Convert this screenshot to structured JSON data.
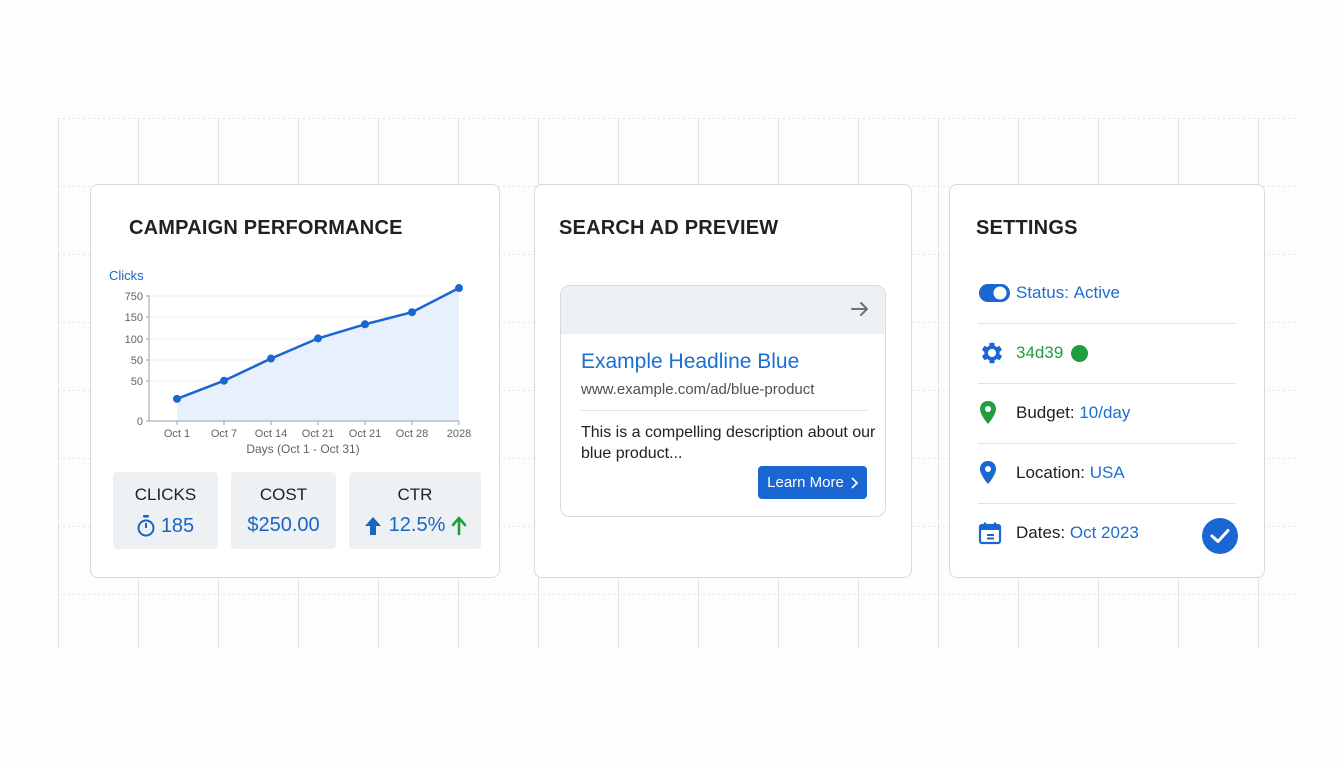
{
  "performance": {
    "title": "CAMPAIGN PERFORMANCE",
    "chart_data": {
      "type": "area",
      "ylabel": "Clicks",
      "xlabel": "Days (Oct 1 - Oct 31)",
      "y_tick_labels": [
        "0",
        "50",
        "50",
        "100",
        "150",
        "750"
      ],
      "x_tick_labels": [
        "Oct 1",
        "Oct 7",
        "Oct 14",
        "Oct 21",
        "Oct 21",
        "Oct 28",
        "2028"
      ],
      "values": [
        22,
        40,
        62,
        82,
        96,
        108,
        132
      ]
    },
    "stats": [
      {
        "label": "CLICKS",
        "value": "185",
        "icon": "timer-icon"
      },
      {
        "label": "COST",
        "value": "$250.00"
      },
      {
        "label": "CTR",
        "value": "12.5%",
        "icon": "arrow-up-icon"
      }
    ]
  },
  "ad_preview": {
    "title": "SEARCH AD PREVIEW",
    "headline": "Example Headline Blue",
    "url": "www.example.com/ad/blue-product",
    "description": "This is a compelling description about our blue product...",
    "button_label": "Learn More"
  },
  "settings": {
    "title": "SETTINGS",
    "status": {
      "label": "Status:",
      "value": "Active"
    },
    "id_value": "34d39",
    "budget": {
      "label": "Budget:",
      "value": "10/day"
    },
    "location": {
      "label": "Location:",
      "value": "USA"
    },
    "dates": {
      "label": "Dates:",
      "value": "Oct 2023"
    }
  },
  "colors": {
    "accent": "#1a66d2",
    "success": "#1e9e3e",
    "area_fill": "#e8f0fd"
  }
}
